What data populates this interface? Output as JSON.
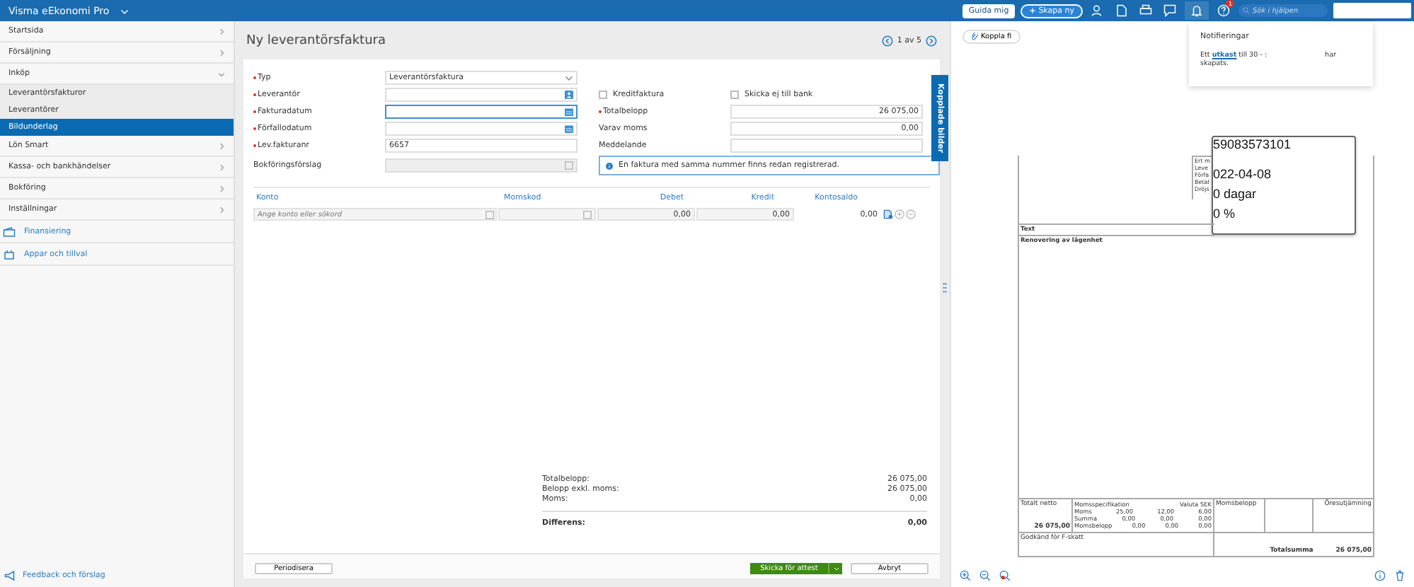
{
  "topbar": {
    "app_name": "Visma eEkonomi Pro",
    "guide_button": "Guida mig",
    "create_button": "Skapa ny",
    "help_badge": "1",
    "search": {
      "placeholder": "Sök i hjälpen"
    }
  },
  "sidebar": {
    "items": [
      {
        "label": "Startsida",
        "kind": "section",
        "expanded": false
      },
      {
        "label": "Försäljning",
        "kind": "section",
        "expanded": false
      },
      {
        "label": "Inköp",
        "kind": "section",
        "expanded": true
      },
      {
        "label": "Leverantörsfakturor",
        "kind": "sub",
        "selected": false
      },
      {
        "label": "Leverantörer",
        "kind": "sub",
        "selected": false
      },
      {
        "label": "Bildunderlag",
        "kind": "sub",
        "selected": true
      },
      {
        "label": "Lön Smart",
        "kind": "section",
        "expanded": false
      },
      {
        "label": "Kassa- och bankhändelser",
        "kind": "section",
        "expanded": false
      },
      {
        "label": "Bokföring",
        "kind": "section",
        "expanded": false
      },
      {
        "label": "Inställningar",
        "kind": "section",
        "expanded": false
      },
      {
        "label": "Finansiering",
        "kind": "link"
      },
      {
        "label": "Appar och tillval",
        "kind": "link"
      }
    ],
    "footer": "Feedback och förslag"
  },
  "form": {
    "title": "Ny leverantörsfaktura",
    "pager": "1 av 5",
    "rows": [
      {
        "left": {
          "label": "Typ",
          "required": true,
          "kind": "select",
          "value": "Leverantörsfaktura",
          "focused": false
        }
      },
      {
        "left": {
          "label": "Leverantör",
          "required": true,
          "kind": "search",
          "focused": false
        },
        "right": {
          "kind": "checkboxes",
          "items": [
            {
              "label": "Kreditfaktura",
              "checked": false
            },
            {
              "label": "Skicka ej till bank",
              "checked": false
            }
          ]
        }
      },
      {
        "left": {
          "label": "Fakturadatum",
          "required": true,
          "kind": "date",
          "focused": true
        },
        "right": {
          "kind": "field",
          "label": "Totalbelopp",
          "required": true,
          "value": "26 075,00"
        }
      },
      {
        "left": {
          "label": "Förfallodatum",
          "required": true,
          "kind": "date",
          "focused": false
        },
        "right": {
          "kind": "field",
          "label": "Varav moms",
          "required": false,
          "value": "0,00"
        }
      },
      {
        "left": {
          "label": "Lev.fakturanr",
          "required": true,
          "kind": "text",
          "value": "6657",
          "focused": false
        },
        "right": {
          "kind": "field",
          "label": "Meddelande",
          "required": false
        }
      },
      {
        "left": {
          "label": "Bokföringsförslag",
          "required": false,
          "kind": "disabled",
          "focused": false
        },
        "right": {
          "kind": "alert",
          "text": "En faktura med samma nummer finns redan registrerad."
        }
      }
    ],
    "side_tab": "Kopplade bilder",
    "table": {
      "columns": [
        "Konto",
        "Momskod",
        "Debet",
        "Kredit",
        "Kontosaldo"
      ],
      "row": {
        "account_placeholder": "Ange konto eller sökord",
        "debet": "0,00",
        "kredit": "0,00",
        "saldo": "0,00"
      }
    },
    "totals": [
      {
        "label": "Totalbelopp:",
        "value": "26 075,00"
      },
      {
        "label": "Belopp exkl. moms:",
        "value": "26 075,00"
      },
      {
        "label": "Moms:",
        "value": "0,00"
      }
    ],
    "difference": {
      "label": "Differens:",
      "value": "0,00"
    },
    "buttons": {
      "periodize": "Periodisera",
      "submit": "Skicka för attest",
      "cancel": "Avbryt"
    }
  },
  "preview": {
    "attach_button": "Koppla fi",
    "notification": {
      "title": "Notifieringar",
      "text_before": "Ett",
      "link": "utkast",
      "text_mid": "till 30 - :",
      "text_end": "har",
      "text_last": "skapats."
    },
    "document": {
      "side_labels": [
        "Ert m",
        "Leve",
        "Förfa",
        "Betal",
        "Dröjs"
      ],
      "overlay_lines": [
        "59083573101",
        "022-04-08",
        "0 dagar",
        "0 %"
      ],
      "text_header": "Text",
      "text_row": "Renovering av lägenhet",
      "net_label": "Totalt netto",
      "net_value": "26 075,00",
      "vat_spec": {
        "title": "Momsspecifikation",
        "currency": "Valuta SEK",
        "rows": [
          [
            "Moms",
            "25,00",
            "12,00",
            "6,00"
          ],
          [
            "Summa",
            "0,00",
            "0,00",
            "0,00"
          ],
          [
            "Momsbelopp",
            "0,00",
            "0,00",
            "0,00"
          ]
        ]
      },
      "vat_amount": "Momsbelopp",
      "rounding": "Öresutjämning",
      "ftax": "Godkänd för F-skatt",
      "total_label": "Totalsumma",
      "total_value": "26 075,00"
    }
  }
}
